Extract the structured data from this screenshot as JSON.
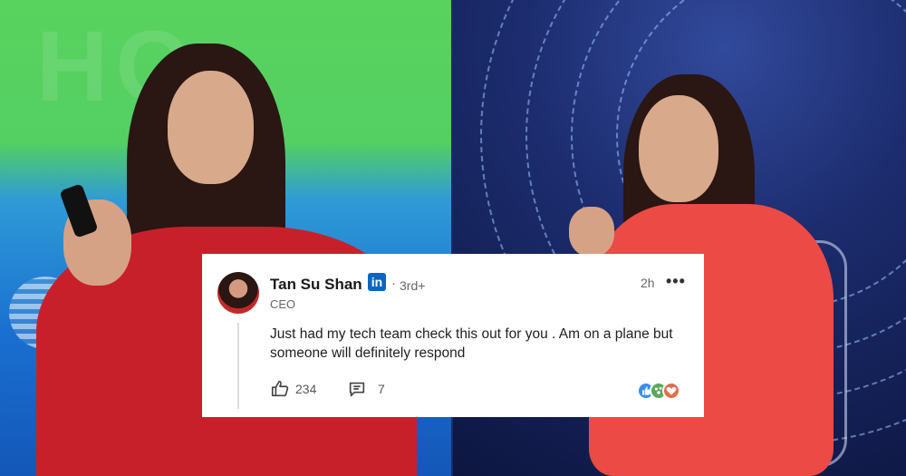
{
  "comment": {
    "author_name": "Tan Su Shan",
    "network_icon": "linkedin-logo-icon",
    "network_badge_text": "in",
    "separator": "·",
    "degree": "3rd+",
    "headline": "CEO",
    "time_ago": "2h",
    "more_icon": "ellipsis-icon",
    "more_label": "•••",
    "text": "Just had my tech team check this out for you . Am on a plane but someone will definitely respond",
    "likes_count": "234",
    "replies_count": "7",
    "reactions": [
      "like-reaction-icon",
      "celebrate-reaction-icon",
      "love-reaction-icon"
    ]
  },
  "colors": {
    "linkedin_blue": "#0a66c2",
    "card_bg": "#ffffff",
    "jacket_red": "#c8202a",
    "dress_coral": "#ec4a45"
  }
}
